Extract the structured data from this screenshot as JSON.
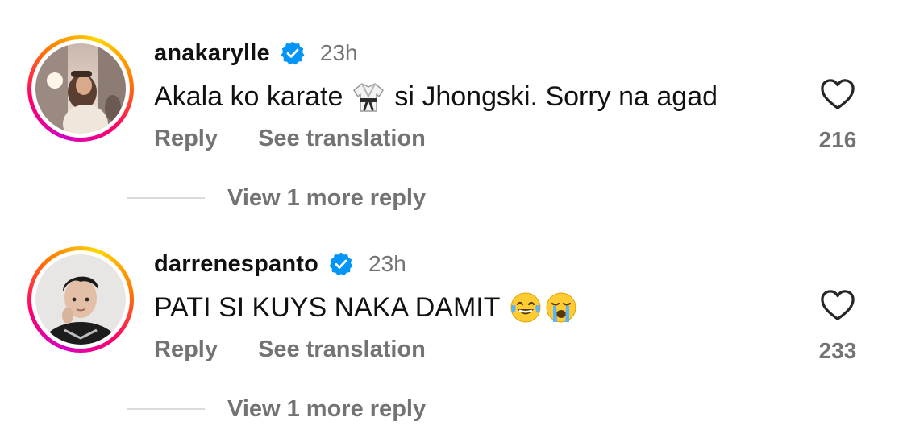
{
  "comments": [
    {
      "username": "anakarylle",
      "time": "23h",
      "text_before": "Akala ko karate",
      "emoji_mid": "karate-uniform",
      "text_after": "si Jhongski. Sorry na agad",
      "reply_label": "Reply",
      "translate_label": "See translation",
      "likes": "216",
      "more_replies_label": "View 1 more reply"
    },
    {
      "username": "darrenespanto",
      "time": "23h",
      "text": "PATI SI KUYS NAKA DAMIT",
      "emojis": [
        "face-with-tears-of-joy",
        "loudly-crying-face"
      ],
      "reply_label": "Reply",
      "translate_label": "See translation",
      "likes": "233",
      "more_replies_label": "View 1 more reply"
    }
  ],
  "colors": {
    "verified_blue": "#0095f6",
    "secondary_text": "#737373",
    "primary_text": "#111111"
  }
}
